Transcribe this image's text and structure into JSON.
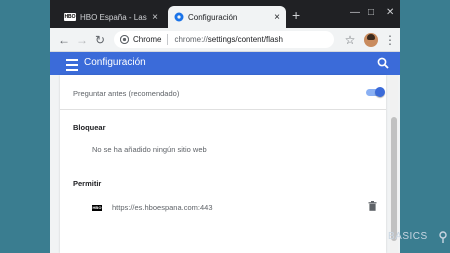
{
  "browser": {
    "tabs": [
      {
        "label": "HBO España - Las mejores se",
        "favicon": "HBO",
        "active": false
      },
      {
        "label": "Configuración",
        "active": true
      }
    ],
    "new_tab_label": "+",
    "window_controls": {
      "minimize": "—",
      "maximize": "□",
      "close": "✕"
    },
    "toolbar": {
      "back": "←",
      "forward": "→",
      "reload": "↻",
      "site_chip": "Chrome",
      "url_scheme": "chrome://",
      "url_path": "settings/content/flash",
      "star": "☆",
      "menu": "⋮"
    }
  },
  "settings": {
    "app_title": "Configuración",
    "ask_first_label": "Preguntar antes (recomendado)",
    "ask_first_enabled": true,
    "block_section": {
      "title": "Bloquear",
      "empty_text": "No se ha añadido ningún sitio web"
    },
    "allow_section": {
      "title": "Permitir",
      "sites": [
        {
          "favicon": "HBO",
          "url": "https://es.hboespana.com:443"
        }
      ]
    }
  },
  "colors": {
    "accent": "#3b6bd9",
    "titlebar": "#202124",
    "background": "#3a7d90"
  },
  "watermark": "BASICS"
}
